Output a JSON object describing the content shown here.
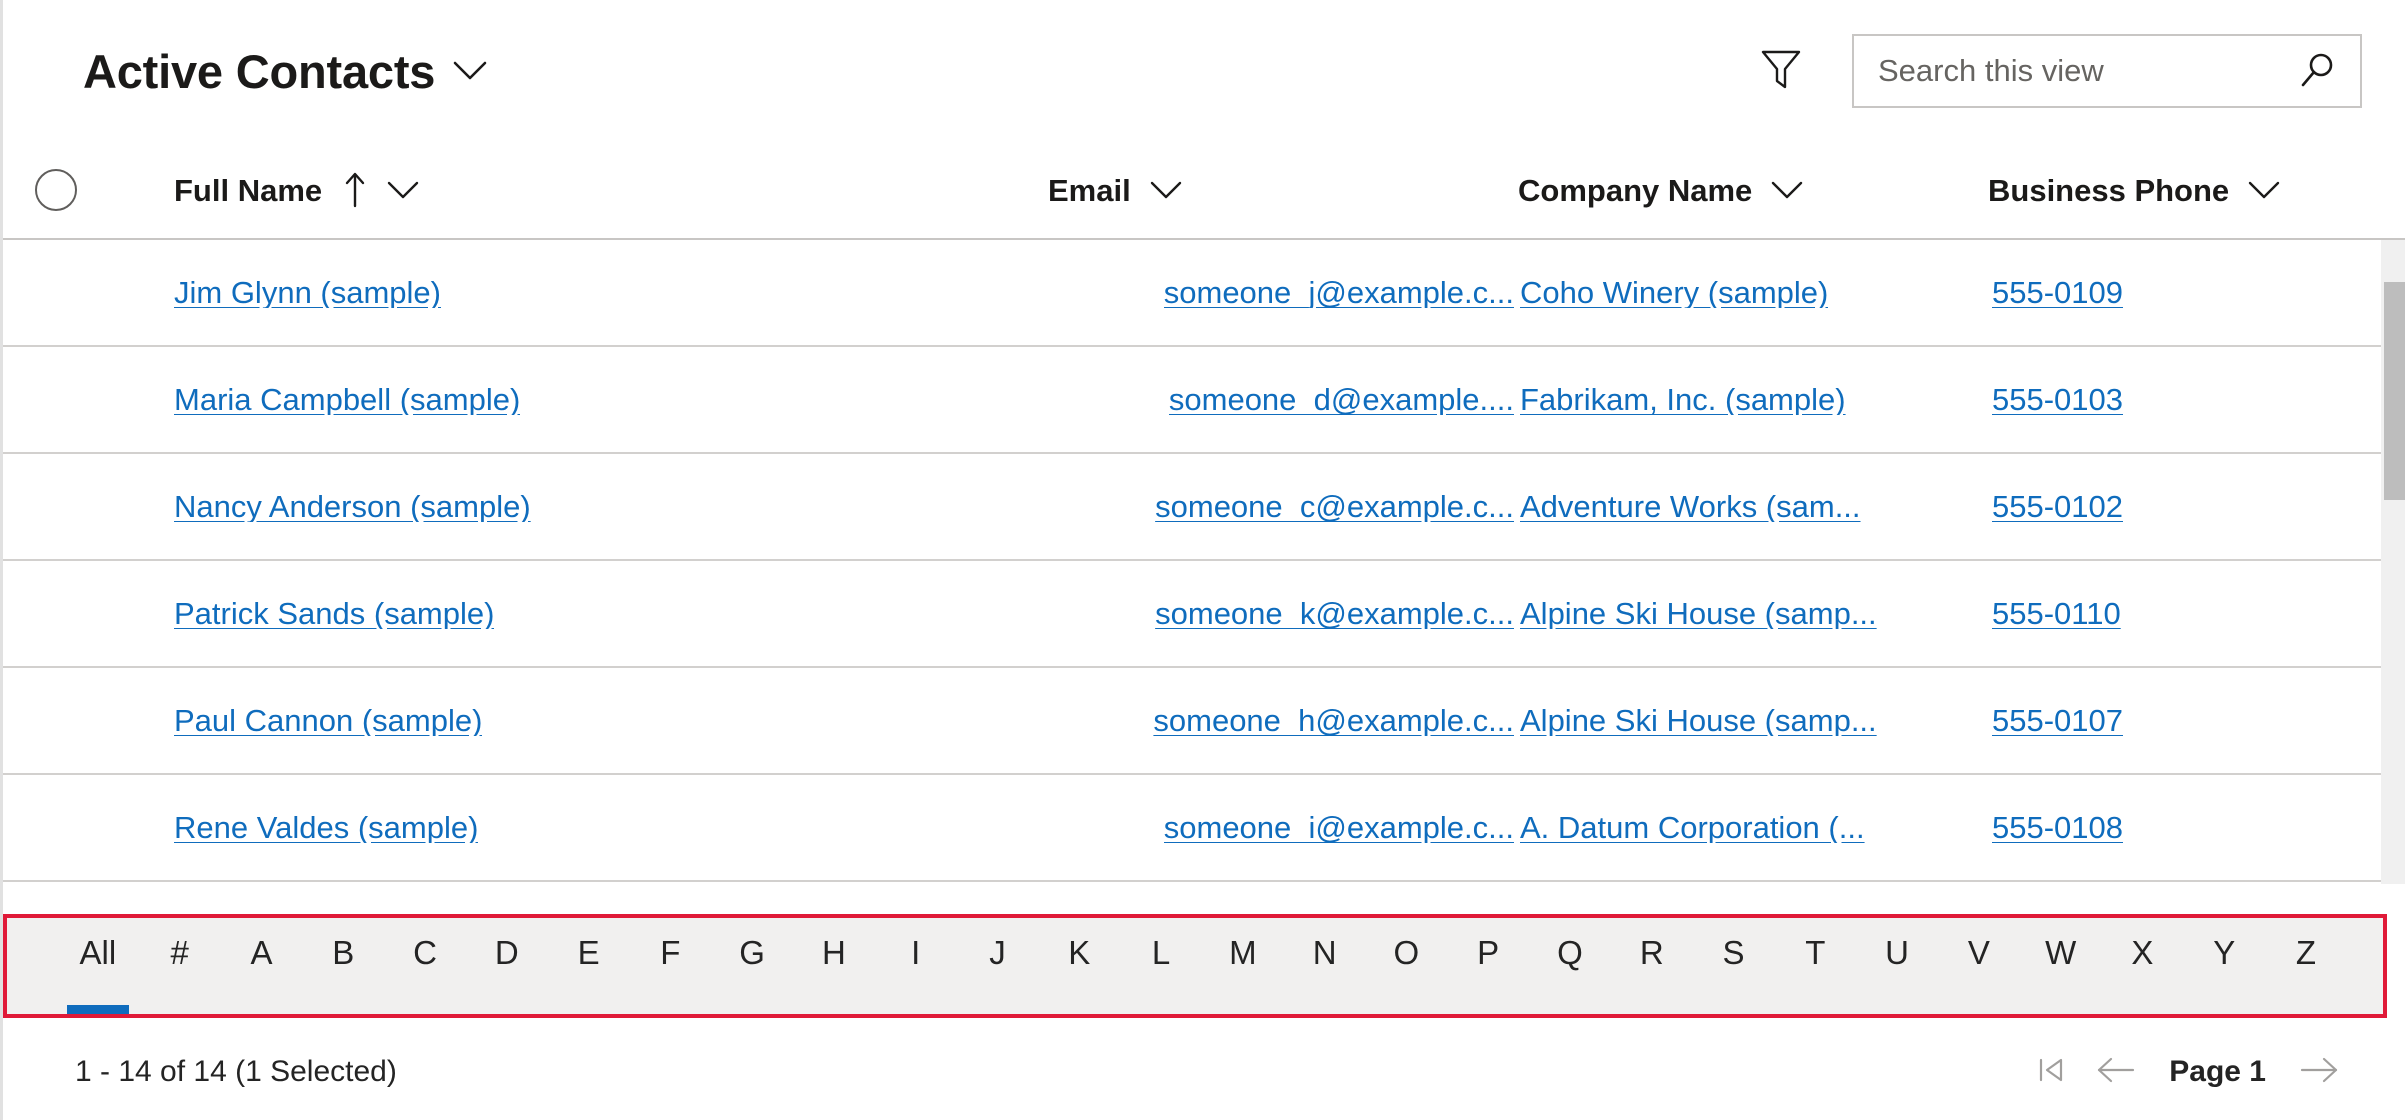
{
  "header": {
    "view_title": "Active Contacts",
    "view_chevron_icon": "chevron-down-icon",
    "filter_icon": "filter-funnel-icon",
    "search": {
      "value": "",
      "placeholder": "Search this view",
      "icon": "search-icon"
    }
  },
  "grid": {
    "select_all_icon": "select-all-circle-icon",
    "columns": [
      {
        "label": "Full Name",
        "sorted": "ascending",
        "sort_icon": "arrow-up-icon",
        "menu_icon": "chevron-down-icon"
      },
      {
        "label": "Email",
        "sorted": "none",
        "menu_icon": "chevron-down-icon"
      },
      {
        "label": "Company Name",
        "sorted": "none",
        "menu_icon": "chevron-down-icon"
      },
      {
        "label": "Business Phone",
        "sorted": "none",
        "menu_icon": "chevron-down-icon"
      }
    ],
    "rows": [
      {
        "full_name": "Jim Glynn (sample)",
        "email": "someone_j@example.c...",
        "company": "Coho Winery (sample)",
        "phone": "555-0109"
      },
      {
        "full_name": "Maria Campbell (sample)",
        "email": "someone_d@example....",
        "company": "Fabrikam, Inc. (sample)",
        "phone": "555-0103"
      },
      {
        "full_name": "Nancy Anderson (sample)",
        "email": "someone_c@example.c...",
        "company": "Adventure Works (sam...",
        "phone": "555-0102"
      },
      {
        "full_name": "Patrick Sands (sample)",
        "email": "someone_k@example.c...",
        "company": "Alpine Ski House (samp...",
        "phone": "555-0110"
      },
      {
        "full_name": "Paul Cannon (sample)",
        "email": "someone_h@example.c...",
        "company": "Alpine Ski House (samp...",
        "phone": "555-0107"
      },
      {
        "full_name": "Rene Valdes (sample)",
        "email": "someone_i@example.c...",
        "company": "A. Datum Corporation (...",
        "phone": "555-0108"
      }
    ]
  },
  "alpha_filter": {
    "highlight_color": "#e01a38",
    "selected": "All",
    "selected_indicator_color": "#0f6cbd",
    "items": [
      "All",
      "#",
      "A",
      "B",
      "C",
      "D",
      "E",
      "F",
      "G",
      "H",
      "I",
      "J",
      "K",
      "L",
      "M",
      "N",
      "O",
      "P",
      "Q",
      "R",
      "S",
      "T",
      "U",
      "V",
      "W",
      "X",
      "Y",
      "Z"
    ]
  },
  "footer": {
    "record_count": "1 - 14 of 14 (1 Selected)",
    "page_label": "Page 1",
    "first_page_icon": "first-page-icon",
    "previous_page_icon": "arrow-left-icon",
    "next_page_icon": "arrow-right-icon"
  },
  "colors": {
    "link": "#0f6cbd",
    "text": "#1b1a19",
    "border": "#d2d0ce",
    "alpha_bg": "#f1f0ef"
  }
}
